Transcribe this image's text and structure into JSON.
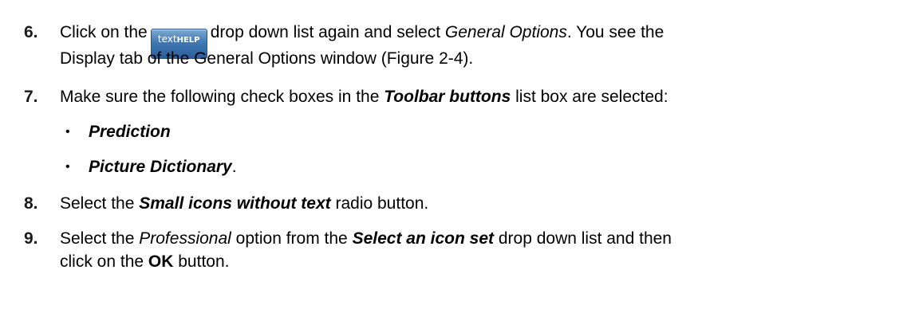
{
  "steps": [
    {
      "number": "6.",
      "part1": "Click on the",
      "logo": {
        "text1": "text",
        "text2": "HELP"
      },
      "part2": "drop down list again and select",
      "part3": "General Options",
      "part4": ". You see the",
      "line2": "Display tab of the General Options window (Figure 2-4)."
    },
    {
      "number": "7.",
      "part1": "Make sure the following check boxes in the",
      "part2": "Toolbar buttons",
      "part3": "list box are selected:"
    },
    {
      "number": "8.",
      "part1": "Select the",
      "part2": "Small icons without text",
      "part3": "radio button."
    },
    {
      "number": "9.",
      "part1": "Select the",
      "part2": "Professional",
      "part3": "option from the",
      "part4": "Select an icon set",
      "part5": "drop down list and then",
      "line2_part1": "click on the",
      "line2_part2": "OK",
      "line2_part3": "button."
    }
  ],
  "bullets": [
    {
      "marker": "•",
      "text": "Prediction",
      "suffix": ""
    },
    {
      "marker": "•",
      "text": "Picture Dictionary",
      "suffix": "."
    }
  ]
}
